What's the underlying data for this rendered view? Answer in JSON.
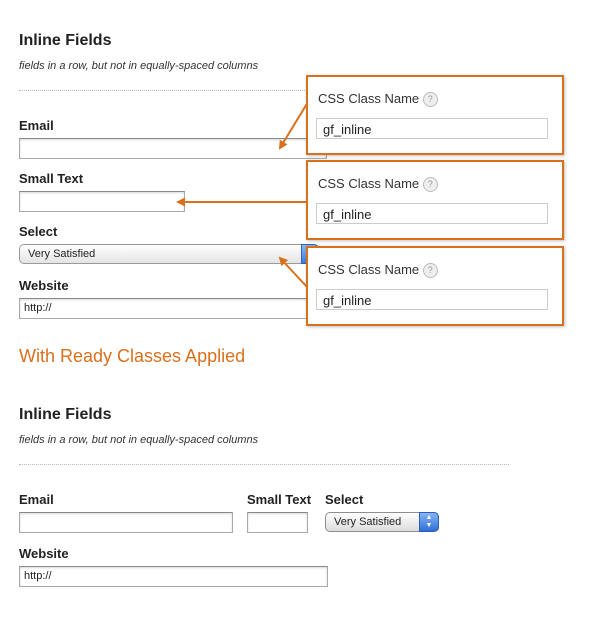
{
  "top_form": {
    "title": "Inline Fields",
    "description": "fields in a row, but not in equally-spaced columns",
    "fields": {
      "email": {
        "label": "Email",
        "value": ""
      },
      "small_text": {
        "label": "Small Text",
        "value": ""
      },
      "select": {
        "label": "Select",
        "value": "Very Satisfied"
      },
      "website": {
        "label": "Website",
        "value": "http://"
      }
    }
  },
  "callouts": [
    {
      "label": "CSS Class Name",
      "help_icon": "?",
      "value": "gf_inline"
    },
    {
      "label": "CSS Class Name",
      "help_icon": "?",
      "value": "gf_inline"
    },
    {
      "label": "CSS Class Name",
      "help_icon": "?",
      "value": "gf_inline"
    }
  ],
  "ready_heading": "With Ready Classes Applied",
  "bottom_form": {
    "title": "Inline Fields",
    "description": "fields in a row, but not in equally-spaced columns",
    "fields": {
      "email": {
        "label": "Email",
        "value": ""
      },
      "small_text": {
        "label": "Small Text",
        "value": ""
      },
      "select": {
        "label": "Select",
        "value": "Very Satisfied"
      },
      "website": {
        "label": "Website",
        "value": "http://"
      }
    }
  },
  "colors": {
    "accent": "#d9701c",
    "select_button": "#3e7ee0"
  }
}
